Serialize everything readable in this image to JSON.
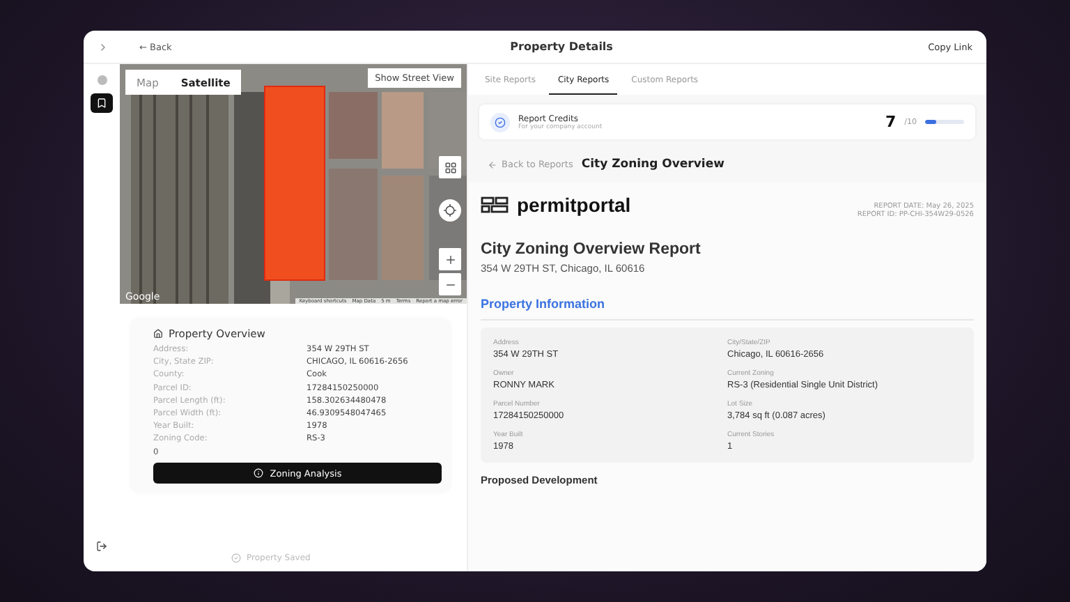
{
  "header": {
    "back": "← Back",
    "title": "Property Details",
    "copy_link": "Copy Link"
  },
  "map": {
    "modes": [
      {
        "label": "Map",
        "selected": false
      },
      {
        "label": "Satellite",
        "selected": true
      }
    ],
    "street_view": "Show Street View",
    "attribution": [
      "Keyboard shortcuts",
      "Map Data",
      "5 m",
      "Terms",
      "Report a map error"
    ],
    "logo": "Google"
  },
  "overview": {
    "title": "Property Overview",
    "rows": [
      {
        "label": "Address:",
        "value": "354 W 29TH ST"
      },
      {
        "label": "City, State ZIP:",
        "value": "CHICAGO, IL 60616-2656"
      },
      {
        "label": "County:",
        "value": "Cook"
      },
      {
        "label": "Parcel ID:",
        "value": "17284150250000"
      },
      {
        "label": "Parcel Length (ft):",
        "value": "158.302634480478"
      },
      {
        "label": "Parcel Width (ft):",
        "value": "46.9309548047465"
      },
      {
        "label": "Year Built:",
        "value": "1978"
      },
      {
        "label": "Zoning Code:",
        "value": "RS-3"
      }
    ],
    "extra": "0",
    "button": "Zoning Analysis"
  },
  "saved": "Property Saved",
  "tabs": [
    {
      "label": "Site Reports",
      "selected": false
    },
    {
      "label": "City Reports",
      "selected": true
    },
    {
      "label": "Custom Reports",
      "selected": false
    }
  ],
  "credits": {
    "title": "Report Credits",
    "subtitle": "For your company account",
    "count": "7",
    "total": "/10",
    "level": 0.3
  },
  "report_nav": {
    "back": "Back to Reports",
    "title": "City Zoning Overview"
  },
  "report": {
    "brand": "permitportal",
    "date": "REPORT DATE: May 26, 2025",
    "id": "REPORT ID: PP-CHI-354W29-0526",
    "title": "City Zoning Overview Report",
    "address": "354 W 29TH ST, Chicago, IL 60616",
    "section": "Property Information",
    "fields": [
      {
        "label": "Address",
        "value": "354 W 29TH ST"
      },
      {
        "label": "City/State/ZIP",
        "value": "Chicago, IL 60616-2656"
      },
      {
        "label": "Owner",
        "value": "RONNY MARK"
      },
      {
        "label": "Current Zoning",
        "value": "RS-3 (Residential Single Unit District)"
      },
      {
        "label": "Parcel Number",
        "value": "17284150250000"
      },
      {
        "label": "Lot Size",
        "value": "3,784 sq ft (0.087 acres)"
      },
      {
        "label": "Year Built",
        "value": "1978"
      },
      {
        "label": "Current Stories",
        "value": "1"
      }
    ],
    "next_section": "Proposed Development"
  }
}
